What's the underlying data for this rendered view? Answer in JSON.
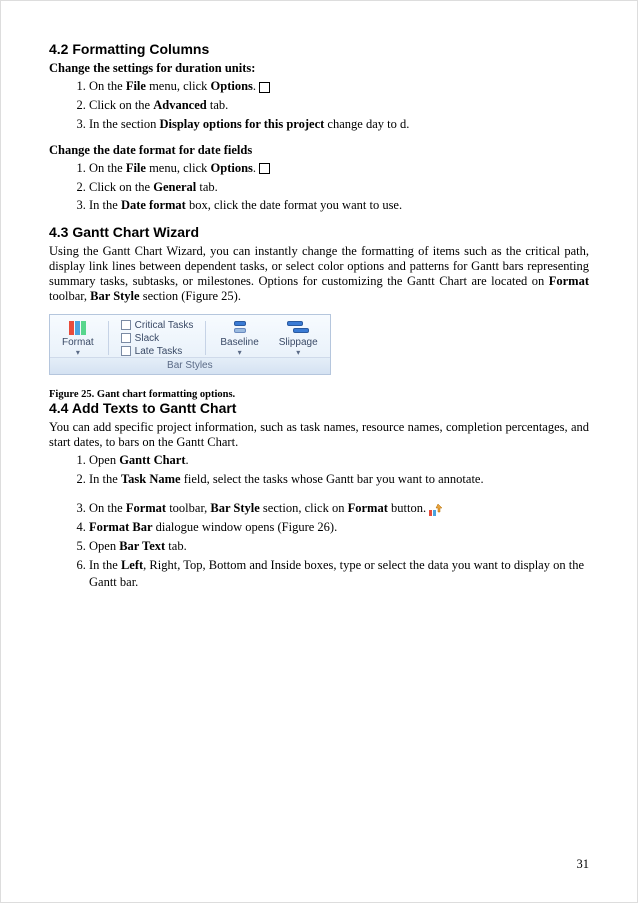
{
  "page_number": "31",
  "section42": {
    "heading": "4.2  Formatting Columns",
    "sub1": "Change the settings for duration units:",
    "steps1": {
      "s1a": "On the ",
      "s1b": "File",
      "s1c": " menu, click ",
      "s1d": "Options",
      "s1e": ".",
      "s2a": "Click on the ",
      "s2b": "Advanced",
      "s2c": " tab.",
      "s3a": "In the section ",
      "s3b": "Display options for this project",
      "s3c": " change day to d."
    },
    "sub2": "Change the date format for date fields",
    "steps2": {
      "s1a": "On the ",
      "s1b": "File",
      "s1c": " menu, click ",
      "s1d": "Options",
      "s1e": ".",
      "s2a": "Click on the ",
      "s2b": "General",
      "s2c": " tab.",
      "s3a": "In the ",
      "s3b": "Date format",
      "s3c": " box, click the date format you want to use."
    }
  },
  "section43": {
    "heading": "4.3  Gantt Chart Wizard",
    "para_a": "Using the Gantt Chart Wizard, you can instantly change the formatting of items such as the critical path, display link lines between dependent tasks, or select color options and patterns for Gantt bars representing summary tasks, subtasks, or milestones. Options for customizing the Gantt Chart are located on ",
    "para_b": "Format",
    "para_c": " toolbar, ",
    "para_d": "Bar Style",
    "para_e": " section (Figure 25).",
    "ribbon": {
      "format": "Format",
      "critical": "Critical Tasks",
      "slack": "Slack",
      "late": "Late Tasks",
      "baseline": "Baseline",
      "slippage": "Slippage",
      "caption": "Bar Styles"
    },
    "fig_caption": "Figure 25. Gant chart formatting options."
  },
  "section44": {
    "heading": "4.4  Add Texts to Gantt Chart",
    "para": "You can add specific project information, such as task names, resource names, completion percentages, and start dates, to bars on the Gantt Chart.",
    "steps": {
      "s1a": "Open ",
      "s1b": "Gantt Chart",
      "s1c": ".",
      "s2a": "In the ",
      "s2b": "Task Name",
      "s2c": " field, select the tasks whose Gantt bar you want to annotate.",
      "s3a": "On the ",
      "s3b": "Format",
      "s3c": " toolbar, ",
      "s3d": "Bar Style",
      "s3e": " section, click on ",
      "s3f": "Format",
      "s3g": " button.",
      "s4a": "",
      "s4b": "Format Bar",
      "s4c": " dialogue window opens (Figure 26).",
      "s5a": "Open ",
      "s5b": "Bar Text",
      "s5c": " tab.",
      "s6a": "In the ",
      "s6b": "Left",
      "s6c": ", Right, Top, Bottom and Inside boxes, type or select the data you want to display on the Gantt bar."
    }
  }
}
